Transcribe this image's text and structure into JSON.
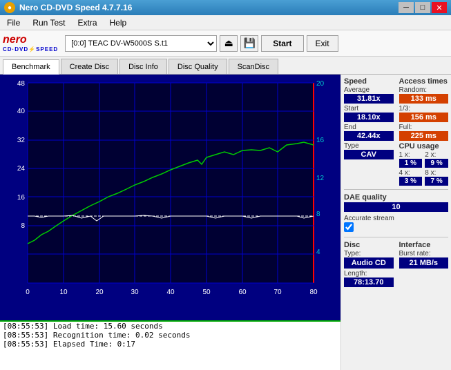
{
  "window": {
    "title": "Nero CD-DVD Speed 4.7.7.16",
    "icon": "●"
  },
  "titlebar": {
    "title": "Nero CD-DVD Speed 4.7.7.16",
    "min_label": "─",
    "max_label": "□",
    "close_label": "✕"
  },
  "menu": {
    "items": [
      "File",
      "Run Test",
      "Extra",
      "Help"
    ]
  },
  "toolbar": {
    "logo_text": "nero",
    "logo_sub": "CD·DVD⚡SPEED",
    "drive_label": "[0:0]  TEAC DV-W5000S S.t1",
    "drive_arrow": "▼",
    "eject_icon": "⏏",
    "save_icon": "💾",
    "start_label": "Start",
    "exit_label": "Exit"
  },
  "tabs": [
    {
      "id": "benchmark",
      "label": "Benchmark",
      "active": true
    },
    {
      "id": "create-disc",
      "label": "Create Disc",
      "active": false
    },
    {
      "id": "disc-info",
      "label": "Disc Info",
      "active": false
    },
    {
      "id": "disc-quality",
      "label": "Disc Quality",
      "active": false
    },
    {
      "id": "scandisc",
      "label": "ScanDisc",
      "active": false
    }
  ],
  "chart": {
    "y_axis_left": [
      "48",
      "40",
      "32",
      "24",
      "16",
      "8",
      ""
    ],
    "y_axis_right": [
      "20",
      "16",
      "12",
      "8",
      "4",
      ""
    ],
    "x_axis": [
      "0",
      "10",
      "20",
      "30",
      "40",
      "50",
      "60",
      "70",
      "80"
    ]
  },
  "stats": {
    "speed_title": "Speed",
    "average_label": "Average",
    "average_value": "31.81x",
    "start_label": "Start",
    "start_value": "18.10x",
    "end_label": "End",
    "end_value": "42.44x",
    "type_label": "Type",
    "type_value": "CAV",
    "access_title": "Access times",
    "random_label": "Random:",
    "random_value": "133 ms",
    "one_third_label": "1/3:",
    "one_third_value": "156 ms",
    "full_label": "Full:",
    "full_value": "225 ms",
    "cpu_title": "CPU usage",
    "cpu_1x_label": "1 x:",
    "cpu_1x_value": "1 %",
    "cpu_2x_label": "2 x:",
    "cpu_2x_value": "9 %",
    "cpu_4x_label": "4 x:",
    "cpu_4x_value": "3 %",
    "cpu_8x_label": "8 x:",
    "cpu_8x_value": "7 %",
    "dae_title": "DAE quality",
    "dae_value": "10",
    "accurate_stream_label": "Accurate stream",
    "accurate_stream_checked": true,
    "disc_title": "Disc",
    "disc_type_label": "Type:",
    "disc_type_value": "Audio CD",
    "disc_length_label": "Length:",
    "disc_length_value": "78:13.70",
    "interface_title": "Interface",
    "burst_rate_label": "Burst rate:",
    "burst_rate_value": "21 MB/s"
  },
  "log": {
    "entries": [
      "[08:55:53]  Load time: 15.60 seconds",
      "[08:55:53]  Recognition time: 0.02 seconds",
      "[08:55:53]  Elapsed Time: 0:17"
    ]
  }
}
